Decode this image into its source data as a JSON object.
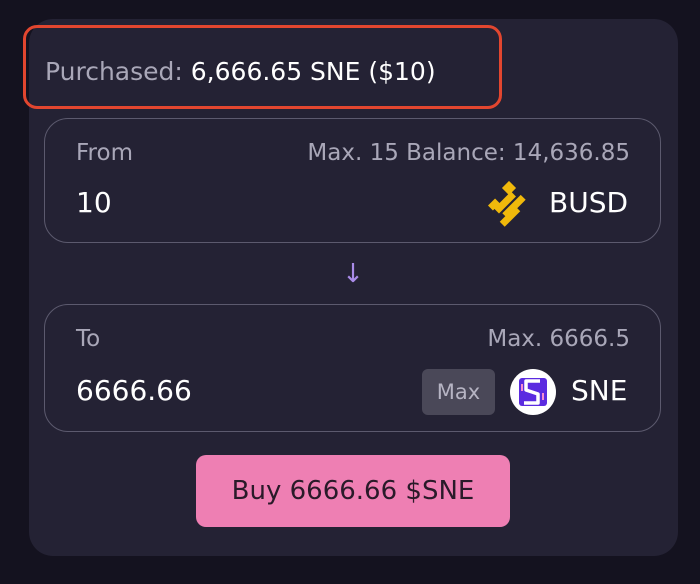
{
  "purchased": {
    "label": "Purchased:",
    "value": "6,666.65 SNE ($10)"
  },
  "from": {
    "label": "From",
    "max_balance": "Max. 15 Balance: 14,636.85",
    "amount": "10",
    "token": "BUSD",
    "token_icon": "busd-logo-icon"
  },
  "arrow": "↓",
  "to": {
    "label": "To",
    "max": "Max. 6666.5",
    "amount": "6666.66",
    "max_button": "Max",
    "token": "SNE",
    "token_icon": "sne-logo-icon"
  },
  "buy_button": "Buy 6666.66 $SNE",
  "colors": {
    "background": "#14121f",
    "card": "#242234",
    "highlight": "#e2462f",
    "buy_button": "#ee7fb3",
    "busd_yellow": "#f0b90b",
    "sne_purple": "#5b2be0"
  }
}
